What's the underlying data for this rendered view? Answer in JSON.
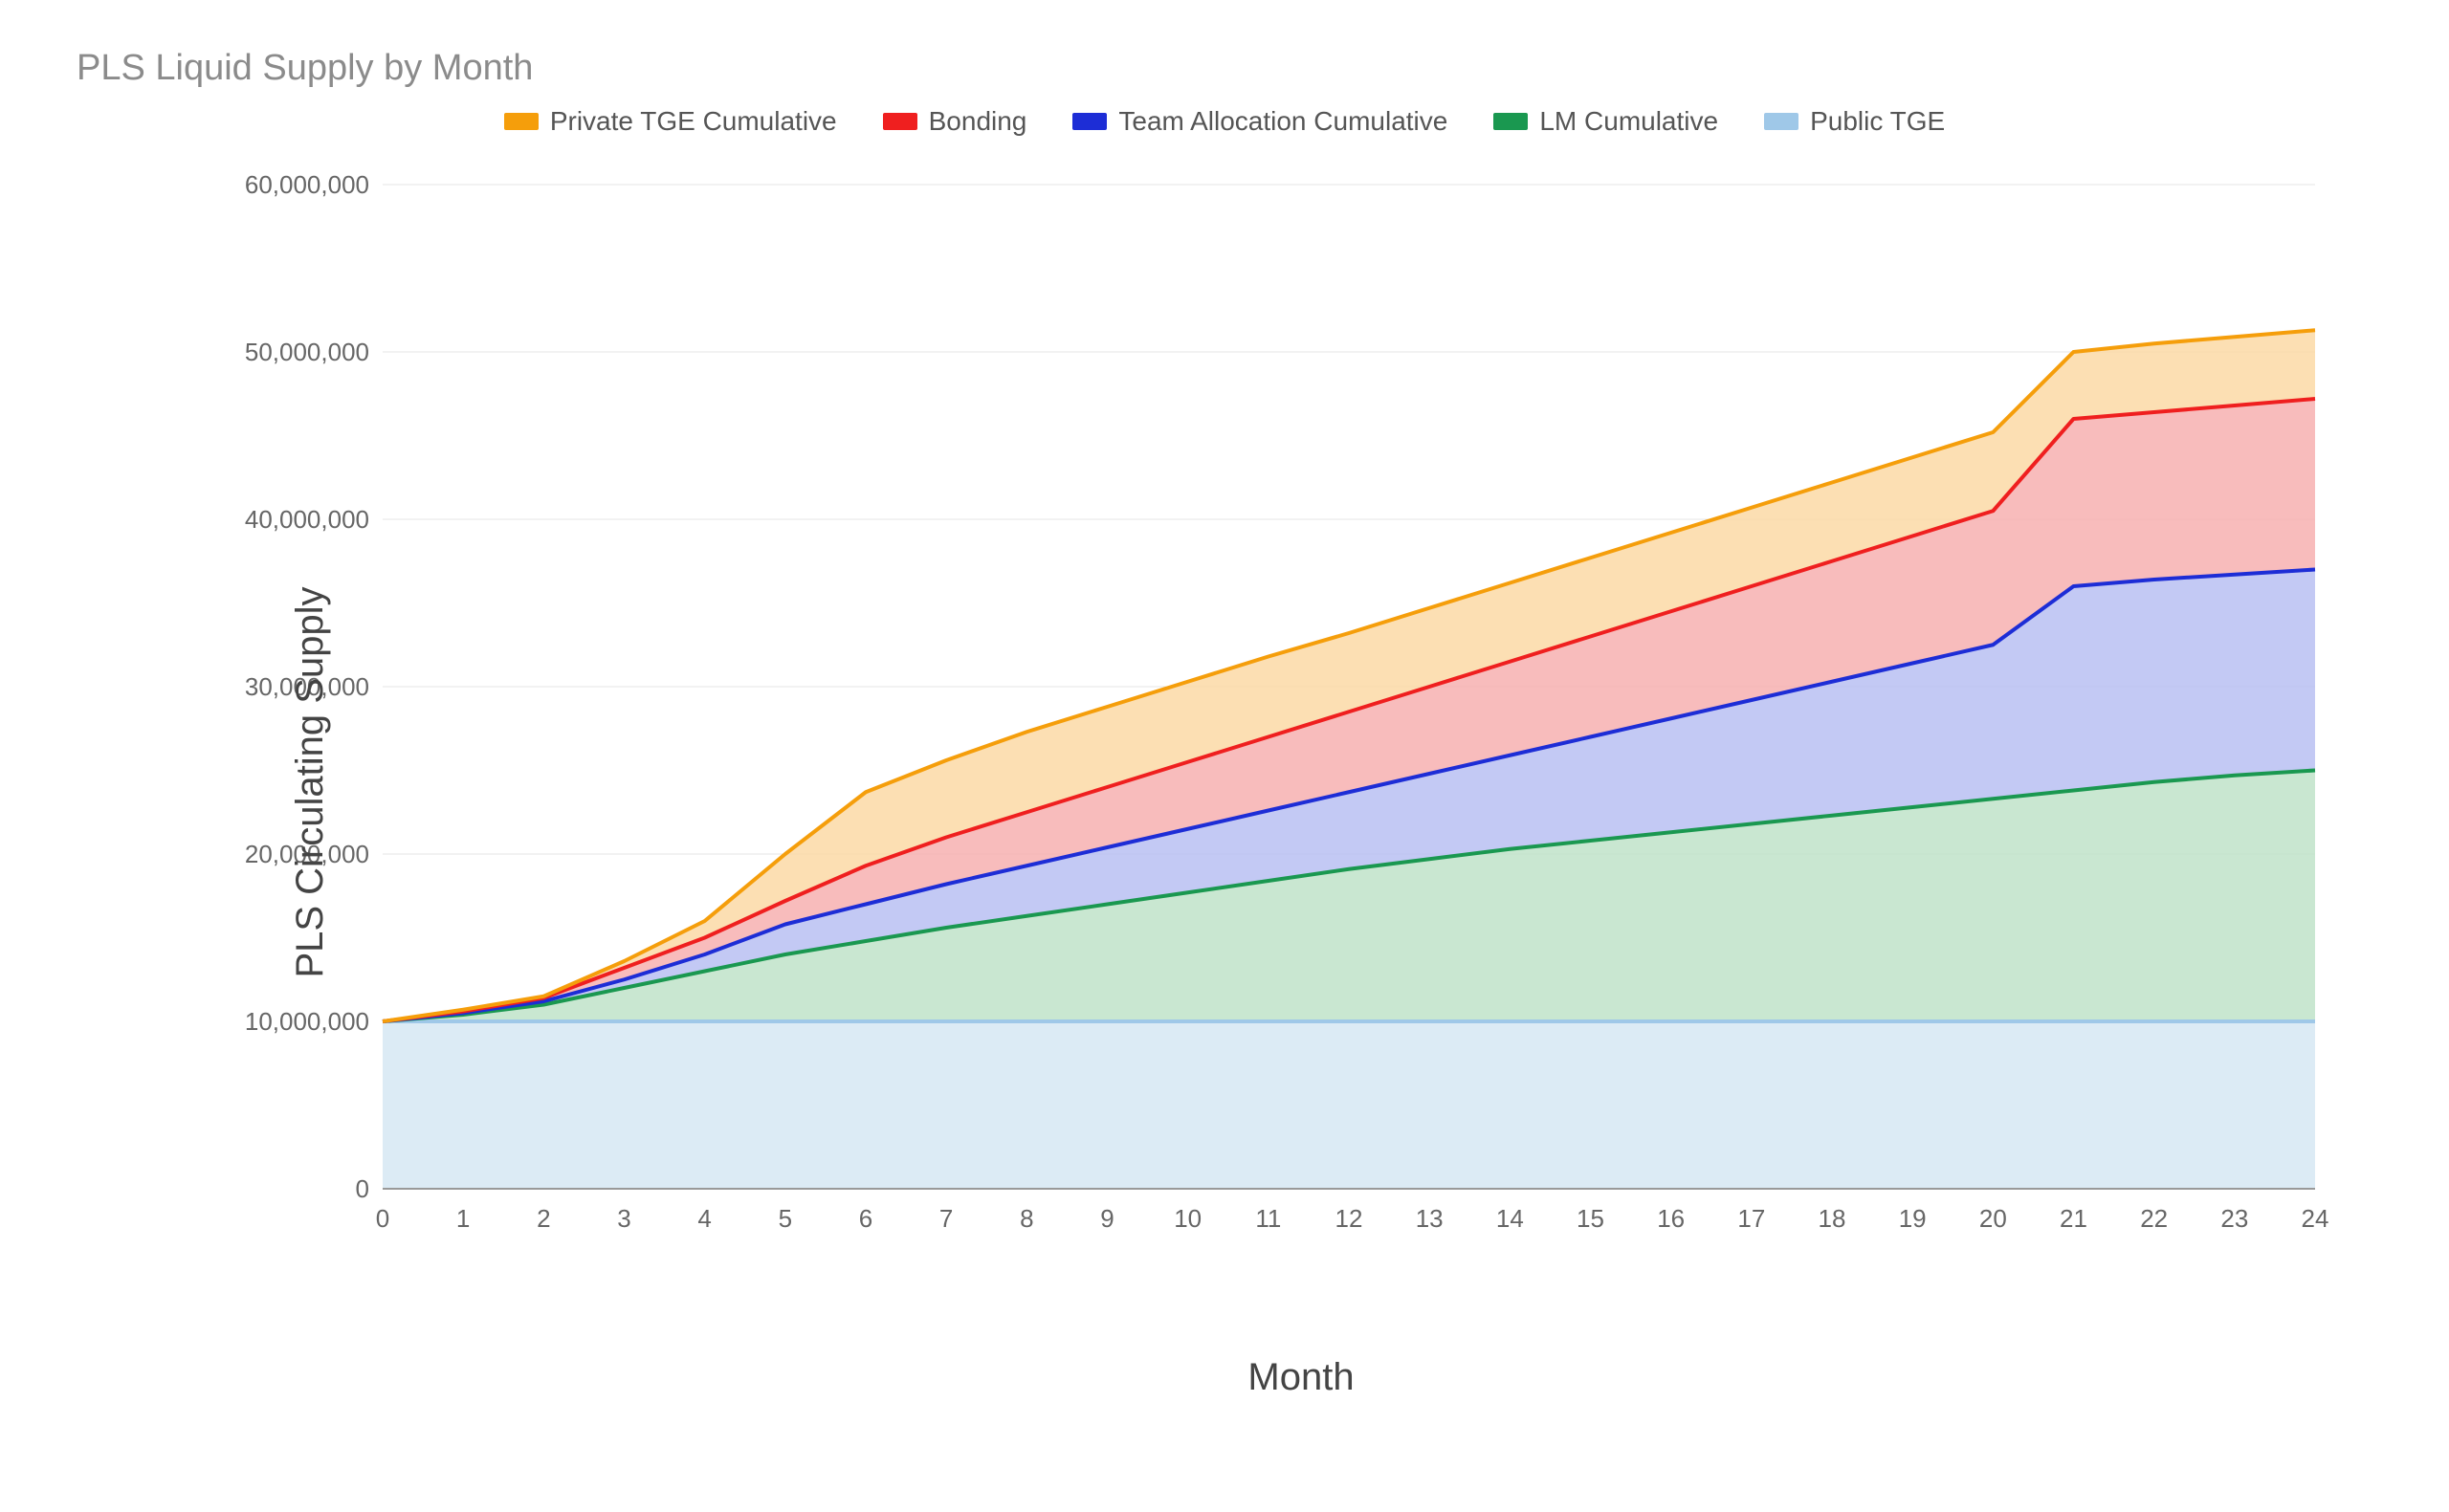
{
  "chart_data": {
    "type": "area",
    "title": "PLS Liquid Supply by Month",
    "xlabel": "Month",
    "ylabel": "PLS Circulating Supply",
    "xlim": [
      0,
      24
    ],
    "ylim": [
      0,
      60000000
    ],
    "x": [
      0,
      1,
      2,
      3,
      4,
      5,
      6,
      7,
      8,
      9,
      10,
      11,
      12,
      13,
      14,
      15,
      16,
      17,
      18,
      19,
      20,
      21,
      22,
      23,
      24
    ],
    "y_ticks": [
      0,
      10000000,
      20000000,
      30000000,
      40000000,
      50000000,
      60000000
    ],
    "y_tick_labels": [
      "0",
      "10,000,000",
      "20,000,000",
      "30,000,000",
      "40,000,000",
      "50,000,000",
      "60,000,000"
    ],
    "legend_position": "top",
    "grid": true,
    "stacked": true,
    "series": [
      {
        "name": "Private TGE Cumulative",
        "stroke": "#f59e0b",
        "fill": "#fcd9a6",
        "cum_values": [
          10000000,
          10700000,
          11500000,
          13600000,
          16000000,
          20000000,
          23700000,
          25600000,
          27300000,
          28800000,
          30300000,
          31800000,
          33200000,
          34700000,
          36200000,
          37700000,
          39200000,
          40700000,
          42200000,
          43700000,
          45200000,
          50000000,
          50500000,
          50900000,
          51300000
        ]
      },
      {
        "name": "Bonding",
        "stroke": "#ef1f1f",
        "fill": "#f7b0b0",
        "cum_values": [
          10000000,
          10600000,
          11400000,
          13200000,
          15000000,
          17200000,
          19300000,
          21000000,
          22500000,
          24000000,
          25500000,
          27000000,
          28500000,
          30000000,
          31500000,
          33000000,
          34500000,
          36000000,
          37500000,
          39000000,
          40500000,
          46000000,
          46400000,
          46800000,
          47200000
        ]
      },
      {
        "name": "Team Allocation Cumulative",
        "stroke": "#1d2dd6",
        "fill": "#b9bff2",
        "cum_values": [
          10000000,
          10500000,
          11200000,
          12500000,
          14000000,
          15800000,
          17000000,
          18200000,
          19300000,
          20400000,
          21500000,
          22600000,
          23700000,
          24800000,
          25900000,
          27000000,
          28100000,
          29200000,
          30300000,
          31400000,
          32500000,
          36000000,
          36400000,
          36700000,
          37000000
        ]
      },
      {
        "name": "LM Cumulative",
        "stroke": "#1a9850",
        "fill": "#bfe3c9",
        "cum_values": [
          10000000,
          10400000,
          11000000,
          12000000,
          13000000,
          14000000,
          14800000,
          15600000,
          16300000,
          17000000,
          17700000,
          18400000,
          19100000,
          19700000,
          20300000,
          20800000,
          21300000,
          21800000,
          22300000,
          22800000,
          23300000,
          23800000,
          24300000,
          24700000,
          25000000
        ]
      },
      {
        "name": "Public TGE",
        "stroke": "#9fc8e8",
        "fill": "#d6e7f3",
        "cum_values": [
          10000000,
          10000000,
          10000000,
          10000000,
          10000000,
          10000000,
          10000000,
          10000000,
          10000000,
          10000000,
          10000000,
          10000000,
          10000000,
          10000000,
          10000000,
          10000000,
          10000000,
          10000000,
          10000000,
          10000000,
          10000000,
          10000000,
          10000000,
          10000000,
          10000000
        ]
      }
    ]
  }
}
